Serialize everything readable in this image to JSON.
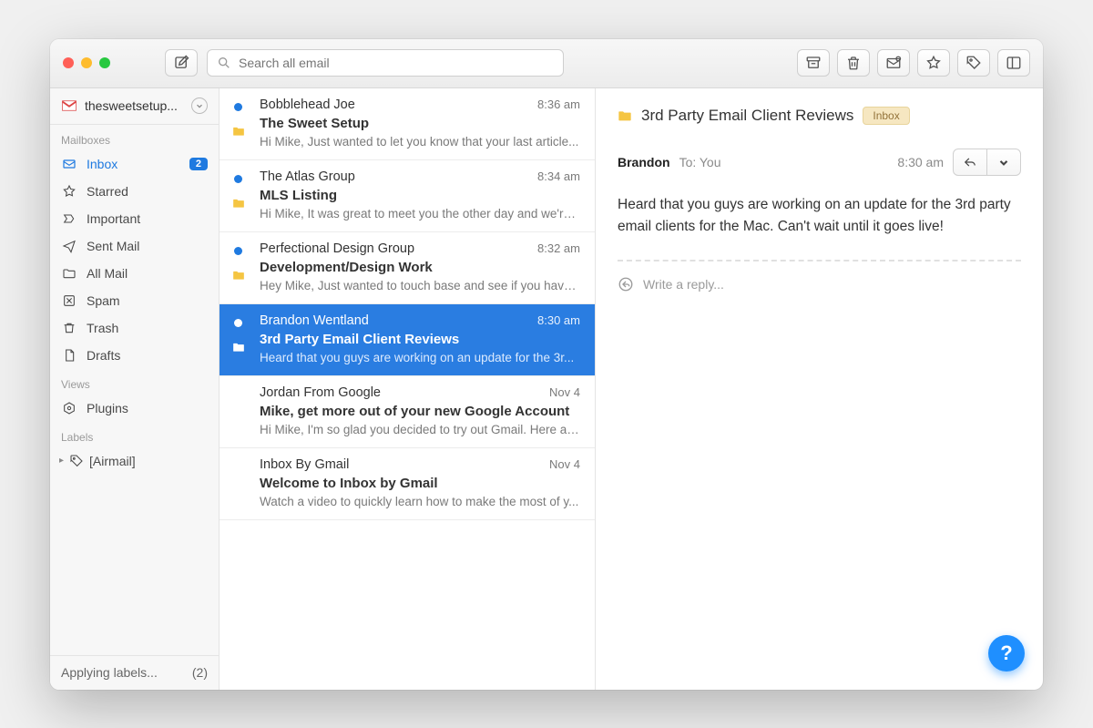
{
  "toolbar": {
    "search_placeholder": "Search all email"
  },
  "account": {
    "name": "thesweetsetup..."
  },
  "sidebar": {
    "sections": {
      "mailboxes": "Mailboxes",
      "views": "Views",
      "labels": "Labels"
    },
    "items": [
      {
        "label": "Inbox",
        "icon": "inbox",
        "badge": "2",
        "active": true
      },
      {
        "label": "Starred",
        "icon": "star"
      },
      {
        "label": "Important",
        "icon": "tag-outline"
      },
      {
        "label": "Sent Mail",
        "icon": "send"
      },
      {
        "label": "All Mail",
        "icon": "folder"
      },
      {
        "label": "Spam",
        "icon": "spam"
      },
      {
        "label": "Trash",
        "icon": "trash"
      },
      {
        "label": "Drafts",
        "icon": "draft"
      }
    ],
    "views": [
      {
        "label": "Plugins",
        "icon": "plugin"
      }
    ],
    "labels": [
      {
        "label": "[Airmail]"
      }
    ],
    "footer": {
      "status": "Applying labels...",
      "count": "(2)"
    }
  },
  "messages": [
    {
      "sender": "Bobblehead Joe",
      "time": "8:36 am",
      "subject": "The Sweet Setup",
      "snippet": "Hi Mike, Just wanted to let you know that your last article...",
      "unread": true,
      "folder": true
    },
    {
      "sender": "The Atlas Group",
      "time": "8:34 am",
      "subject": "MLS Listing",
      "snippet": "Hi Mike, It was great to meet you the other day and we're...",
      "unread": true,
      "folder": true
    },
    {
      "sender": "Perfectional Design Group",
      "time": "8:32 am",
      "subject": "Development/Design Work",
      "snippet": "Hey Mike, Just wanted to touch base and see if you have ...",
      "unread": true,
      "folder": true
    },
    {
      "sender": "Brandon Wentland",
      "time": "8:30 am",
      "subject": "3rd Party Email Client Reviews",
      "snippet": "Heard that you guys are working on an update for the 3r...",
      "unread": true,
      "folder": true,
      "selected": true
    },
    {
      "sender": "Jordan From Google",
      "time": "Nov 4",
      "subject": "Mike, get more out of your new Google Account",
      "snippet": "Hi Mike, I'm so glad you decided to try out Gmail. Here ar..."
    },
    {
      "sender": "Inbox By Gmail",
      "time": "Nov 4",
      "subject": "Welcome to Inbox by Gmail",
      "snippet": "Watch a video to quickly learn how to make the most of y..."
    }
  ],
  "reader": {
    "title": "3rd Party Email Client Reviews",
    "chip": "Inbox",
    "from": "Brandon",
    "to_label": "To: You",
    "time": "8:30 am",
    "body": "Heard that you guys  are working on an update for the 3rd party email clients for the Mac.  Can't wait until it goes live!",
    "reply_placeholder": "Write a reply..."
  },
  "help": "?"
}
